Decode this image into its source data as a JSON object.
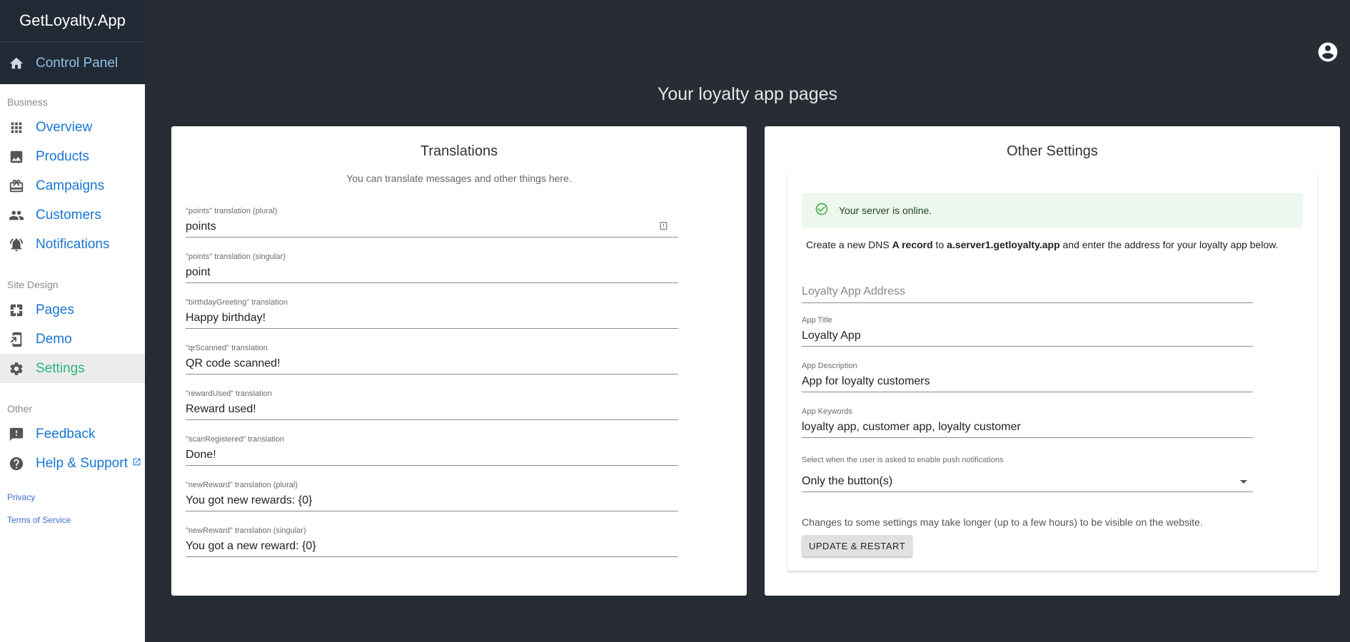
{
  "sidebar": {
    "brand": "GetLoyalty.App",
    "control_panel": "Control Panel",
    "sections": {
      "business": "Business",
      "site_design": "Site Design",
      "other": "Other"
    },
    "items": {
      "overview": "Overview",
      "products": "Products",
      "campaigns": "Campaigns",
      "customers": "Customers",
      "notifications": "Notifications",
      "pages": "Pages",
      "demo": "Demo",
      "settings": "Settings",
      "feedback": "Feedback",
      "help": "Help & Support"
    },
    "links": {
      "privacy": "Privacy",
      "terms": "Terms of Service"
    },
    "active_item": "settings"
  },
  "header": {
    "title": "Your loyalty app pages"
  },
  "translations": {
    "title": "Translations",
    "subtitle": "You can translate messages and other things here.",
    "fields": [
      {
        "label": "\"points\" translation (plural)",
        "value": "points"
      },
      {
        "label": "\"points\" translation (singular)",
        "value": "point"
      },
      {
        "label": "\"birthdayGreeting\" translation",
        "value": "Happy birthday!"
      },
      {
        "label": "\"qrScanned\" translation",
        "value": "QR code scanned!"
      },
      {
        "label": "\"rewardUsed\" translation",
        "value": "Reward used!"
      },
      {
        "label": "\"scanRegistered\" translation",
        "value": "Done!"
      },
      {
        "label": "\"newReward\" translation (plural)",
        "value": "You got new rewards: {0}"
      },
      {
        "label": "\"newReward\" translation (singular)",
        "value": "You got a new reward: {0}"
      }
    ]
  },
  "other_settings": {
    "title": "Other Settings",
    "status": "Your server is online.",
    "dns": {
      "prefix": "Create a new DNS ",
      "record": "A record",
      "middle": " to ",
      "server": "a.server1.getloyalty.app",
      "suffix": " and enter the address for your loyalty app below."
    },
    "address_placeholder": "Loyalty App Address",
    "fields": [
      {
        "label": "App Title",
        "value": "Loyalty App"
      },
      {
        "label": "App Description",
        "value": "App for loyalty customers"
      },
      {
        "label": "App Keywords",
        "value": "loyalty app, customer app, loyalty customer"
      }
    ],
    "push_select": {
      "label": "Select when the user is asked to enable push notifications",
      "value": "Only the button(s)"
    },
    "note": "Changes to some settings may take longer (up to a few hours) to be visible on the website.",
    "update_button": "UPDATE & RESTART"
  },
  "colors": {
    "background": "#282c34",
    "sidebar_header": "#222a35",
    "link": "#1976d2",
    "active": "#2cb67d",
    "success_bg": "#edf7ed",
    "success_icon": "#4caf50"
  }
}
